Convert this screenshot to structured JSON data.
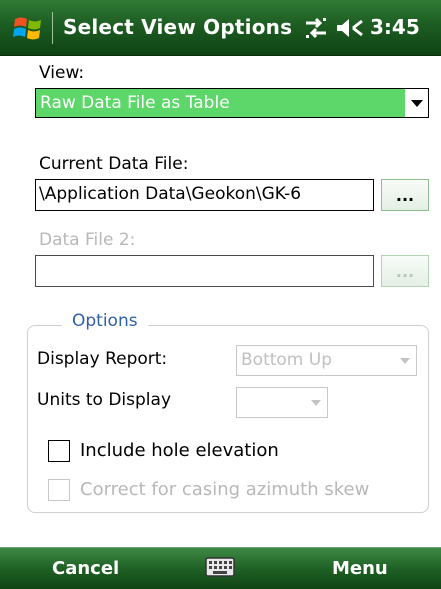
{
  "titlebar": {
    "title": "Select View Options",
    "time": "3:45",
    "icons": [
      "windows-start-icon",
      "connectivity-icon",
      "volume-icon"
    ]
  },
  "form": {
    "view_label": "View:",
    "view_value": "Raw Data File as Table",
    "current_file_label": "Current Data File:",
    "current_file_value": "\\Application Data\\Geokon\\GK-6",
    "browse_label": "...",
    "file2_label": "Data File 2:",
    "file2_value": "",
    "browse2_label": "..."
  },
  "options": {
    "legend": "Options",
    "display_report_label": "Display Report:",
    "display_report_value": "Bottom Up",
    "units_label": "Units to Display",
    "units_value": "",
    "include_hole_label": "Include hole elevation",
    "include_hole_checked": false,
    "correct_casing_label": "Correct for casing azimuth skew",
    "correct_casing_checked": false
  },
  "bottombar": {
    "left_softkey": "Cancel",
    "right_softkey": "Menu",
    "center_icon": "keyboard-icon"
  },
  "colors": {
    "titlebar_green": "#1d5d22",
    "selection_green": "#5dd66a",
    "legend_blue": "#2f5fa8",
    "disabled_gray": "#b8b8b8"
  }
}
